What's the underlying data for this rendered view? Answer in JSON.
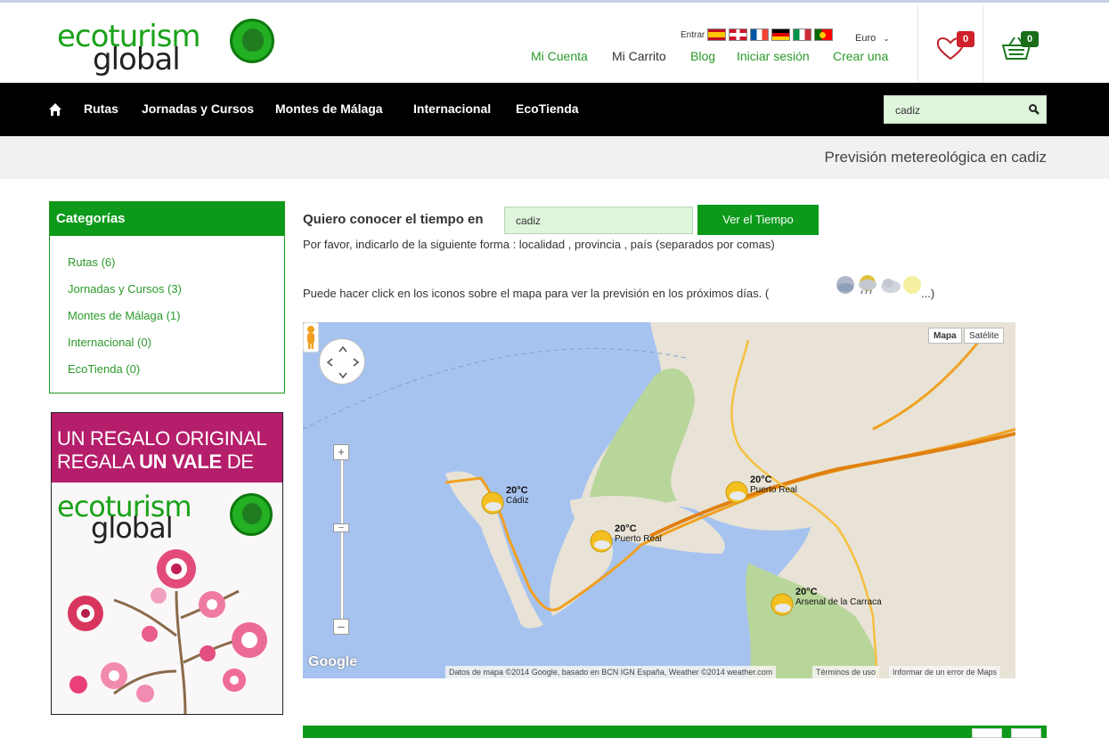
{
  "header": {
    "logo": {
      "line1": "ecoturism",
      "line2": "global"
    },
    "language_label": "Entrar",
    "flags": [
      "es-flag",
      "uk-flag",
      "fr-flag",
      "de-flag",
      "it-flag",
      "pt-flag"
    ],
    "currency": "Euro",
    "links": {
      "account": "Mi Cuenta",
      "cart": "Mi Carrito",
      "blog": "Blog",
      "login": "Iniciar sesión",
      "create": "Crear una"
    },
    "wishlist_count": "0",
    "cart_count": "0",
    "colors": {
      "brand_green": "#0d9a1a",
      "wish_badge": "#d0212a"
    }
  },
  "nav": {
    "items": [
      "Rutas",
      "Jornadas y Cursos",
      "Montes de Málaga",
      "Internacional",
      "EcoTienda"
    ],
    "search_value": "cadiz"
  },
  "subheader": {
    "title": "Previsión metereológica en cadiz"
  },
  "sidebar": {
    "heading": "Categorías",
    "items": [
      "Rutas (6)",
      "Jornadas y Cursos (3)",
      "Montes de Málaga (1)",
      "Internacional (0)",
      "EcoTienda (0)"
    ],
    "promo": {
      "line1": "UN REGALO ORIGINAL",
      "line2_pre": "REGALA ",
      "line2_bold": "UN VALE",
      "line2_post": " DE",
      "logo1": "ecoturism",
      "logo2": "global"
    }
  },
  "main": {
    "question_label": "Quiero conocer el tiempo en",
    "location_value": "cadiz",
    "button_label": "Ver el Tiempo",
    "hint_format": "Por favor, indicarlo de la siguiente forma : localidad , provincia , país (separados por comas)",
    "hint_map": "Puede hacer click en los iconos sobre el mapa para ver la previsión en los próximos días. (",
    "hint_map_end": "...)"
  },
  "map": {
    "type_buttons": [
      "Mapa",
      "Satélite"
    ],
    "attribution": "Datos de mapa ©2014 Google, basado en BCN IGN España, Weather ©2014 weather.com",
    "terms": "Términos de uso",
    "report": "Informar de un error de Maps",
    "google_label": "Google",
    "markers": [
      {
        "temp": "20°C",
        "name": "Cádiz"
      },
      {
        "temp": "20°C",
        "name": "Puerto Real"
      },
      {
        "temp": "20°C",
        "name": "Puerto Real"
      },
      {
        "temp": "20°C",
        "name": "Arsenal de la Carraca"
      }
    ]
  }
}
